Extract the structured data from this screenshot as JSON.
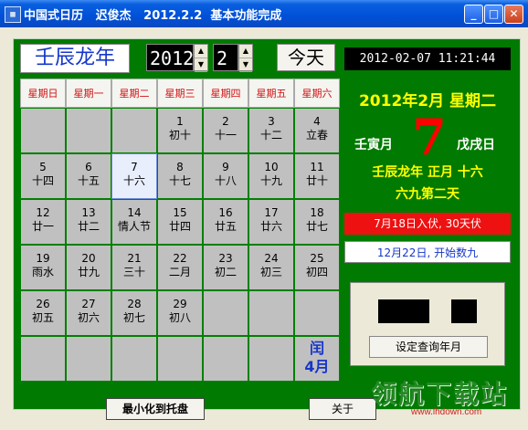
{
  "window": {
    "title": "中国式日历   迟俊杰   2012.2.2  基本功能完成",
    "icon": "calendar-icon"
  },
  "controls": {
    "year_label": "壬辰龙年",
    "year_value": "2012",
    "month_value": "2",
    "today_label": "今天",
    "clock": "2012-02-07 11:21:44"
  },
  "calendar": {
    "weekdays": [
      "星期日",
      "星期一",
      "星期二",
      "星期三",
      "星期四",
      "星期五",
      "星期六"
    ],
    "rows": [
      [
        [
          "",
          ""
        ],
        [
          "",
          ""
        ],
        [
          "",
          ""
        ],
        [
          "1",
          "初十"
        ],
        [
          "2",
          "十一"
        ],
        [
          "3",
          "十二"
        ],
        [
          "4",
          "立春"
        ]
      ],
      [
        [
          "5",
          "十四"
        ],
        [
          "6",
          "十五"
        ],
        [
          "7",
          "十六"
        ],
        [
          "8",
          "十七"
        ],
        [
          "9",
          "十八"
        ],
        [
          "10",
          "十九"
        ],
        [
          "11",
          "廿十"
        ]
      ],
      [
        [
          "12",
          "廿一"
        ],
        [
          "13",
          "廿二"
        ],
        [
          "14",
          "情人节"
        ],
        [
          "15",
          "廿四"
        ],
        [
          "16",
          "廿五"
        ],
        [
          "17",
          "廿六"
        ],
        [
          "18",
          "廿七"
        ]
      ],
      [
        [
          "19",
          "雨水"
        ],
        [
          "20",
          "廿九"
        ],
        [
          "21",
          "三十"
        ],
        [
          "22",
          "二月"
        ],
        [
          "23",
          "初二"
        ],
        [
          "24",
          "初三"
        ],
        [
          "25",
          "初四"
        ]
      ],
      [
        [
          "26",
          "初五"
        ],
        [
          "27",
          "初六"
        ],
        [
          "28",
          "初七"
        ],
        [
          "29",
          "初八"
        ],
        [
          "",
          ""
        ],
        [
          "",
          ""
        ],
        [
          "",
          ""
        ]
      ],
      [
        [
          "",
          ""
        ],
        [
          "",
          ""
        ],
        [
          "",
          ""
        ],
        [
          "",
          ""
        ],
        [
          "",
          ""
        ],
        [
          "",
          ""
        ],
        [
          "闰",
          "4月"
        ]
      ]
    ]
  },
  "info": {
    "date_line": "2012年2月  星期二",
    "big_day": "7",
    "ganzhi_month": "壬寅月",
    "ganzhi_day": "戊戌日",
    "lunar_line": "壬辰龙年  正月  十六",
    "jiu_line": "六九第二天",
    "fu_note": "7月18日入伏, 30天伏",
    "shujiu_note": "12月22日, 开始数九",
    "query_button": "设定查询年月"
  },
  "footer": {
    "minimize_label": "最小化到托盘",
    "about_label": "关于"
  },
  "watermark": {
    "text": "领航下载站",
    "url": "www.lhdown.com"
  },
  "colors": {
    "panel": "#007a00",
    "highlight_yellow": "#ffff00",
    "red": "#ff0000"
  }
}
